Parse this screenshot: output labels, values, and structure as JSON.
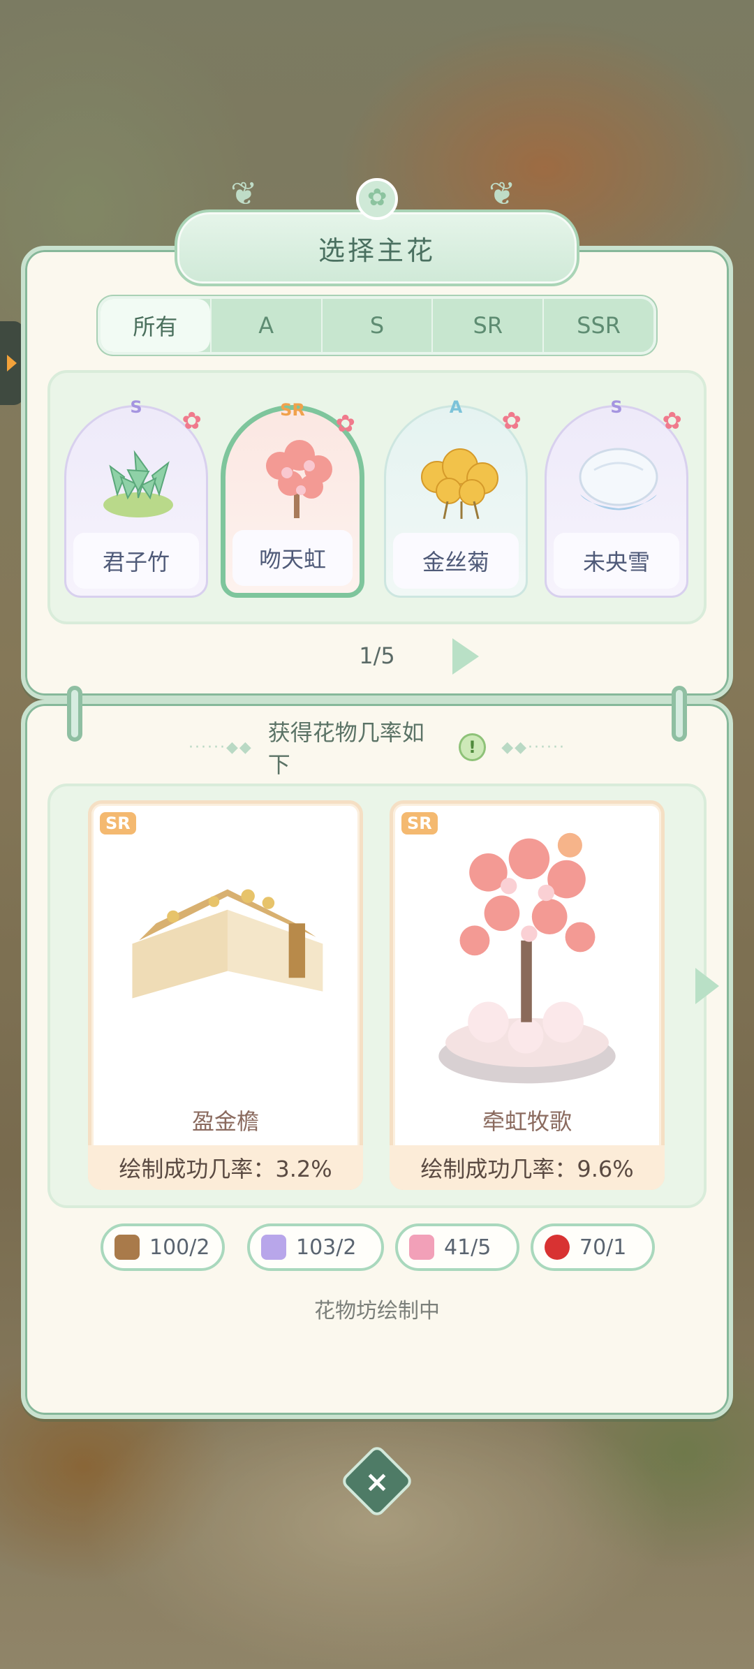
{
  "dialog": {
    "title": "选择主花"
  },
  "tabs": [
    {
      "label": "所有",
      "active": true
    },
    {
      "label": "A",
      "active": false
    },
    {
      "label": "S",
      "active": false
    },
    {
      "label": "SR",
      "active": false
    },
    {
      "label": "SSR",
      "active": false
    }
  ],
  "flowers": [
    {
      "name": "君子竹",
      "rarity": "S",
      "selected": false,
      "color": "#8fd1a7"
    },
    {
      "name": "吻天虹",
      "rarity": "SR",
      "selected": true,
      "color": "#f39a94"
    },
    {
      "name": "金丝菊",
      "rarity": "A",
      "selected": false,
      "color": "#f2c24a"
    },
    {
      "name": "未央雪",
      "rarity": "S",
      "selected": false,
      "color": "#e9f1fa"
    }
  ],
  "pagination": {
    "text": "1/5"
  },
  "probability": {
    "title": "获得花物几率如下",
    "info_icon": "!",
    "items": [
      {
        "name": "盈金檐",
        "rarity": "SR",
        "rate": "绘制成功几率：3.2%"
      },
      {
        "name": "牵虹牧歌",
        "rarity": "SR",
        "rate": "绘制成功几率：9.6%"
      }
    ]
  },
  "resources": [
    {
      "icon": "brown-paint-tube-icon",
      "value": "100/2",
      "color": "#a97a4a"
    },
    {
      "icon": "purple-paint-tube-icon",
      "value": "103/2",
      "color": "#b8a6ea"
    },
    {
      "icon": "pink-paint-tube-icon",
      "value": "41/5",
      "color": "#f2a0b8"
    },
    {
      "icon": "red-potion-jar-icon",
      "value": "70/1",
      "color": "#d83232"
    }
  ],
  "status": "花物坊绘制中",
  "close_label": "×"
}
